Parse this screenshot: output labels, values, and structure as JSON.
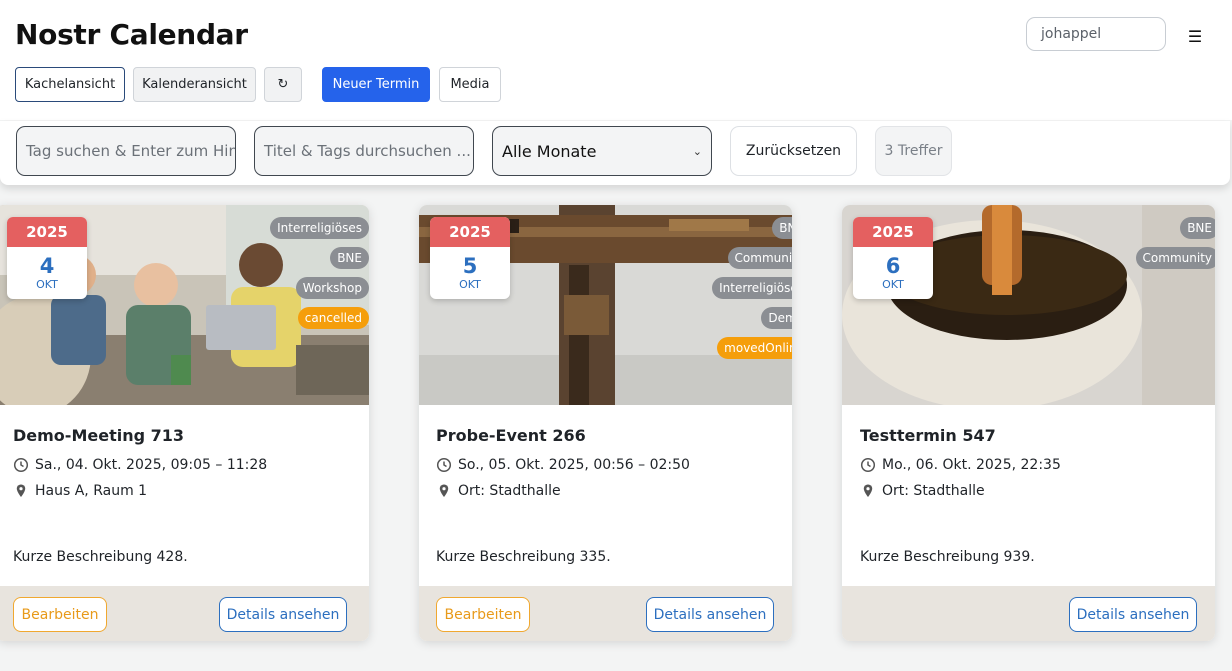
{
  "header": {
    "title": "Nostr Calendar",
    "user_value": "johappel",
    "menu_icon": "☰"
  },
  "toolbar": {
    "tile_view": "Kachelansicht",
    "calendar_view": "Kalenderansicht",
    "refresh_icon": "↻",
    "new_event": "Neuer Termin",
    "media": "Media"
  },
  "filters": {
    "tag_placeholder": "Tag suchen & Enter zum Hinzufügen",
    "text_placeholder": "Titel & Tags durchsuchen ...",
    "month_selected": "Alle Monate",
    "reset": "Zurücksetzen",
    "count": "3 Treffer"
  },
  "colors": {
    "primary": "#2563eb",
    "date_header": "#e46060",
    "date_text": "#2c6fbf",
    "tag": "#8b8e93",
    "status_tag": "#f59e0b",
    "edit": "#e89a1a"
  },
  "events": [
    {
      "year": "2025",
      "day": "4",
      "month": "OKT",
      "tags": [
        "Interreligiöses",
        "BNE",
        "Workshop"
      ],
      "status": "cancelled",
      "title": "Demo-Meeting 713",
      "datetime": "Sa., 04. Okt. 2025, 09:05 – 11:28",
      "location": "Haus A, Raum 1",
      "description": "Kurze Beschreibung 428.",
      "edit_label": "Bearbeiten",
      "details_label": "Details ansehen",
      "image": "office-meeting-photo"
    },
    {
      "year": "2025",
      "day": "5",
      "month": "OKT",
      "tags": [
        "BNE",
        "Community",
        "Interreligiöses",
        "Demo"
      ],
      "status": "movedOnline",
      "title": "Probe-Event 266",
      "datetime": "So., 05. Okt. 2025, 00:56 – 02:50",
      "location": "Ort: Stadthalle",
      "description": "Kurze Beschreibung 335.",
      "edit_label": "Bearbeiten",
      "details_label": "Details ansehen",
      "image": "wooden-cross-photo"
    },
    {
      "year": "2025",
      "day": "6",
      "month": "OKT",
      "tags": [
        "BNE",
        "Community"
      ],
      "status": "",
      "title": "Testtermin 547",
      "datetime": "Mo., 06. Okt. 2025, 22:35",
      "location": "Ort: Stadthalle",
      "description": "Kurze Beschreibung 939.",
      "details_label": "Details ansehen",
      "image": "pottery-bowl-photo"
    }
  ]
}
